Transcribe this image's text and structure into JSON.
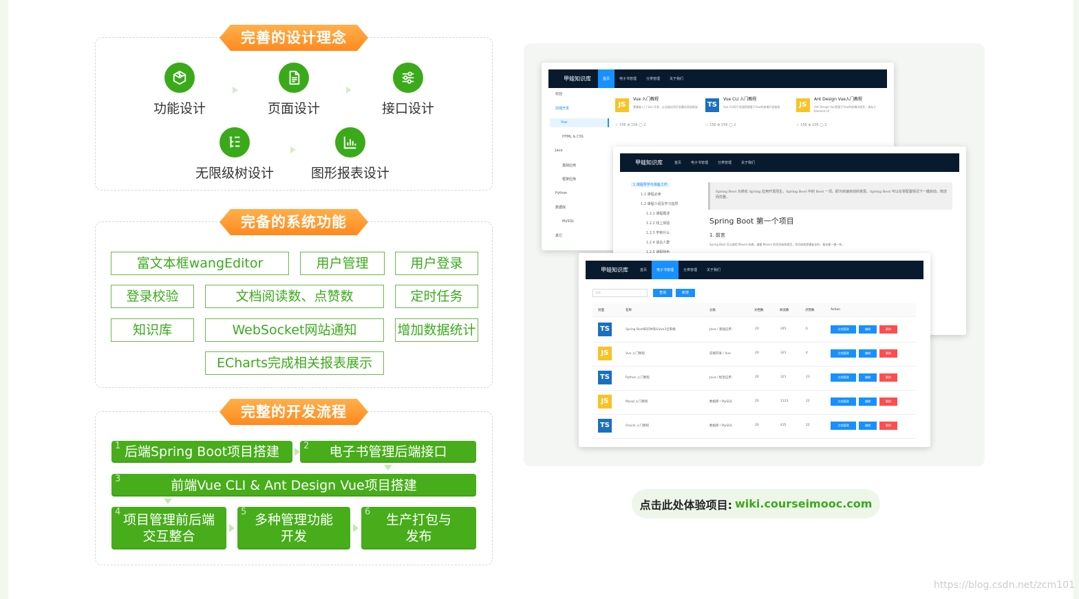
{
  "section1": {
    "title": "完善的设计理念",
    "features": [
      {
        "label": "功能设计",
        "icon": "box-icon"
      },
      {
        "label": "页面设计",
        "icon": "document-icon"
      },
      {
        "label": "接口设计",
        "icon": "sliders-icon"
      },
      {
        "label": "无限级树设计",
        "icon": "tree-list-icon"
      },
      {
        "label": "图形报表设计",
        "icon": "bar-chart-icon"
      }
    ]
  },
  "section2": {
    "title": "完备的系统功能",
    "tags": [
      "富文本框wangEditor",
      "用户管理",
      "用户登录",
      "登录校验",
      "文档阅读数、点赞数",
      "定时任务",
      "知识库",
      "WebSocket网站通知",
      "增加数据统计",
      "ECharts完成相关报表展示"
    ]
  },
  "section3": {
    "title": "完整的开发流程",
    "steps": [
      {
        "num": "1",
        "label": "后端Spring Boot项目搭建"
      },
      {
        "num": "2",
        "label": "电子书管理后端接口"
      },
      {
        "num": "3",
        "label": "前端Vue CLI & Ant Design Vue项目搭建"
      },
      {
        "num": "4",
        "label": "项目管理前后端\n交互整合"
      },
      {
        "num": "5",
        "label": "多种管理功能\n开发"
      },
      {
        "num": "6",
        "label": "生产打包与\n发布"
      }
    ]
  },
  "preview": {
    "brand": "甲蛙知识库",
    "nav": [
      "首页",
      "电子书管理",
      "分类管理",
      "关于我们"
    ],
    "winA": {
      "sidebar": [
        "欢迎",
        "前端开发",
        "Vue",
        "HTML & CSS",
        "Java",
        "基础应用",
        "框架应用",
        "Python",
        "数据库",
        "MySQL",
        "其它"
      ],
      "books": [
        {
          "icon": "JS",
          "title": "Vue 入门教程",
          "desc": "零基础入门 Vue 开发，企业级应用开发最佳首选框架",
          "stats": "☆ 156   ⊕ 156   ◯ 2"
        },
        {
          "icon": "TS",
          "title": "Vue CLI 入门教程",
          "desc": "Vue CLI用于快速搭建基于Vue的前端开发架构",
          "stats": "☆ 156   ⊕ 156   ◯ 2"
        },
        {
          "icon": "JS",
          "title": "Ant Design Vue入门教程",
          "desc": "Ant Design Vue是基于Vue的前端UI组件，类似于Element UI",
          "stats": "☆ 156   ⊕ 156   ◯ 2"
        }
      ]
    },
    "winB": {
      "tree": [
        "1 课程导学与准备工作",
        "1.1 课程必读",
        "1.2 课程介绍及学习指导",
        "1.2.1 课程概述",
        "1.2.2 线上体验",
        "1.2.3 学到什么",
        "1.2.4 适合人群",
        "1.2.5 课程特色"
      ],
      "quote": "Spring Boot 为简化 Spring 应用开发而生，Spring Boot 中的 Boot 一词，即为快速启动的意思。Spring Boot 可以在零配置情况下一键启动，简洁而优雅。",
      "heading": "Spring Boot 第一个项目",
      "subheading": "1. 前言",
      "para": "Spring Boot 可以使用 Maven 构建，遵循 Maven 的项目结构规范，项目结构是模板化的，基本都一模一样。"
    },
    "winC": {
      "search_placeholder": "名称",
      "query_label": "查询",
      "add_label": "新增",
      "columns": [
        "封面",
        "名称",
        "分类",
        "文档数",
        "阅读数",
        "点赞数",
        "Action"
      ],
      "rows": [
        {
          "icon": "TS",
          "name": "Spring Boot知识体系&Vue3全家桶",
          "category": "Java / 基础应用",
          "docs": "20",
          "views": "245",
          "likes": "6"
        },
        {
          "icon": "JS",
          "name": "Vue 入门教程",
          "category": "前端开发 / Vue",
          "docs": "20",
          "views": "321",
          "likes": "4"
        },
        {
          "icon": "TS",
          "name": "Python 入门教程",
          "category": "Java / 框架应用",
          "docs": "20",
          "views": "321",
          "likes": "23"
        },
        {
          "icon": "JS",
          "name": "Mysql 入门教程",
          "category": "数据库 / MySQL",
          "docs": "20",
          "views": "1123",
          "likes": "22"
        },
        {
          "icon": "TS",
          "name": "Oracle 入门教程",
          "category": "数据库 / MySQL",
          "docs": "20",
          "views": "435",
          "likes": "22"
        }
      ],
      "actions": [
        "文档管理",
        "编辑",
        "删除"
      ]
    }
  },
  "cta": {
    "prefix": "点击此处体验项目:",
    "link": "wiki.courseimooc.com"
  },
  "watermark": "https://blog.csdn.net/zcm101",
  "colors": {
    "green": "#3aaa1a",
    "orange": "#ff8a1e",
    "navy": "#071a2e",
    "blue": "#1890ff"
  }
}
